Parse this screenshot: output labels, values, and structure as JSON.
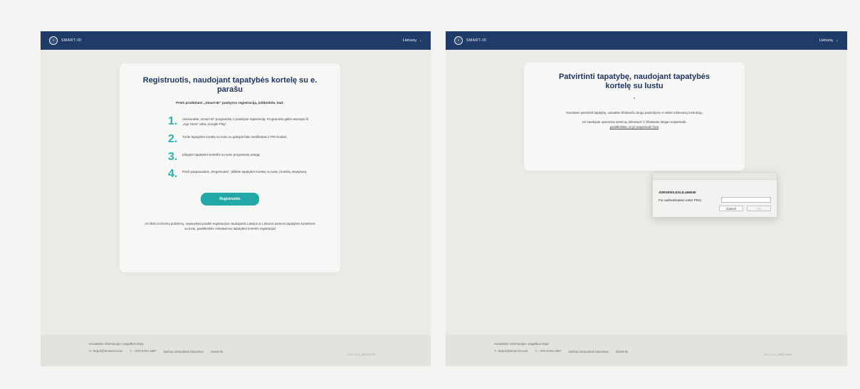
{
  "brand": "SMART-ID",
  "language": "Lietuvių",
  "left": {
    "title": "Registruotis, naudojant tapatybės kortelę su e. parašu",
    "subtitle": "Prieš pradėdami „Smart-ID“ paskyros registraciją, įsitikinkite, kad:",
    "steps": [
      {
        "num": "1.",
        "text": "Atsisiuntėte „Smart-ID“ programėlę ir pradėjote registraciją. Programėlę galite atsisiųsti iš „App Store“ arba „Google Play“."
      },
      {
        "num": "2.",
        "text": "Turite tapatybės kortelę su lustu su galiojančiais sertifikatais ir PIN kodais;"
      },
      {
        "num": "3.",
        "text": "Įdiegėte tapatybės kortelės su lustu programinę įrangą;"
      },
      {
        "num": "4.",
        "text": "Prieš paspausdami „Registruotis“, įkiškite tapatybės kortelę su lustu į kortelių skaitytuvą."
      }
    ],
    "button": "Registruotis",
    "note": "Jei iškilo techninių problemų, nepavyksta pradėti registracijos naudojantis Latvijos ar Lietuvos asmens tapatybės kortelėmis su lustu, pasitikrinkite reikalavimus tapatybės kortelės registracijai"
  },
  "right": {
    "title": "Patvirtinti tapatybę, naudojant tapatybės kortelę su lustu",
    "text1": "Norėdami patvirtinti tapatybę, sulaukite iššokančio lango pasirodymo ir sekite tolimesnių instrukcijų",
    "text2_a": "Jei naudojate operacinę sistemą „Windows“ ir iššokantis langas nepasirodė,",
    "text2_b": "pasitikrinkite, ar jis nepasirodė fone",
    "dialog": {
      "user": "JÜRGENS,EGLE,496040",
      "prompt": "For authentication enter PIN1:",
      "cancel": "Cancel",
      "ok": "OK"
    }
  },
  "footer": {
    "heading": "Kontaktinė informacija ir pagalbos linija:",
    "email": "help.lt@smart-id.com",
    "phone": "+370 6704 1807",
    "faq": "Dažnai užduodami klausimai",
    "site": "Smart-ID",
    "version": "14.7.124_9063.8.56"
  }
}
